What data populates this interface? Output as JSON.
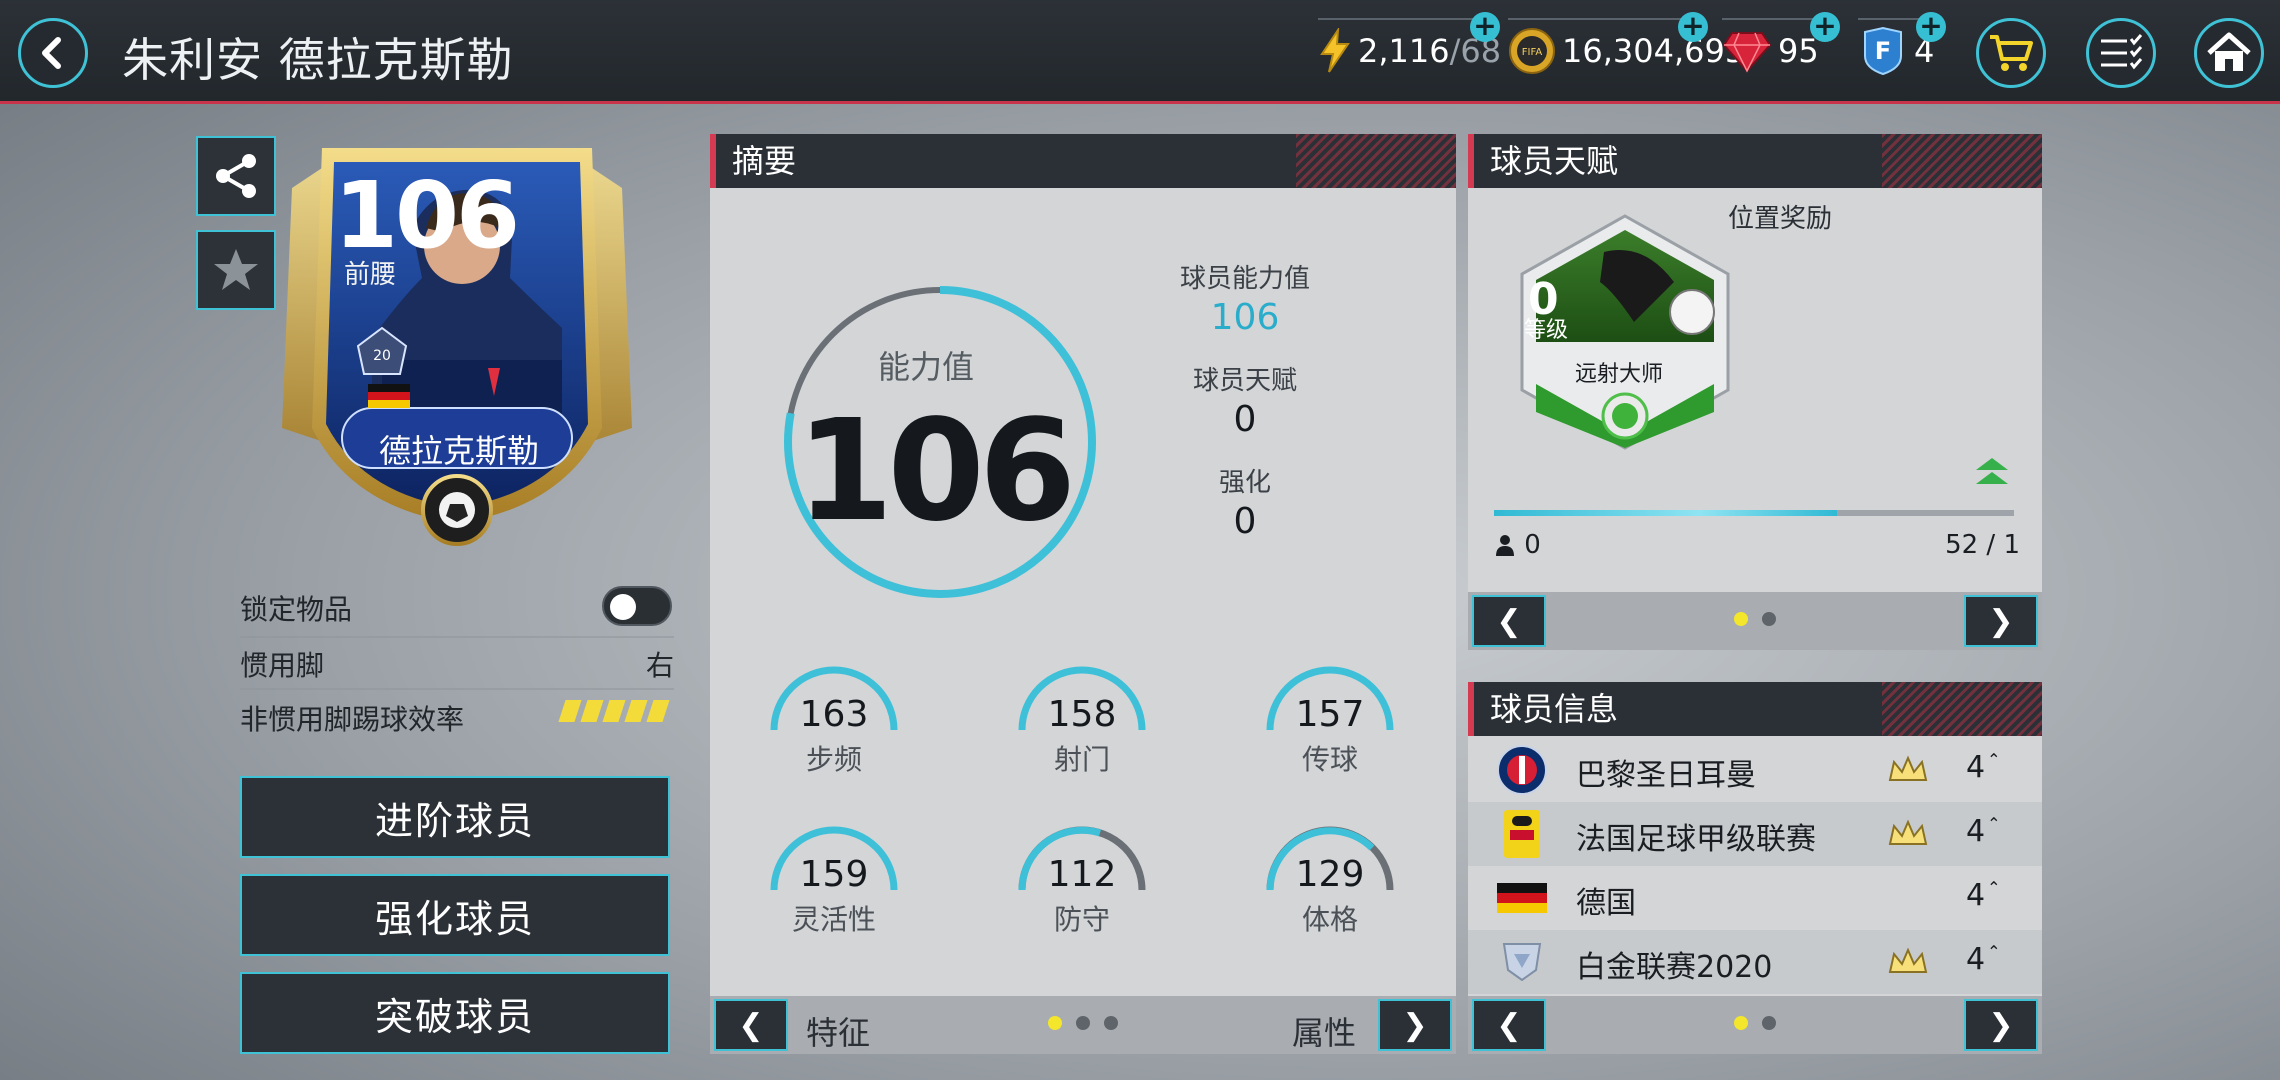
{
  "header": {
    "title": "朱利安 德拉克斯勒",
    "energy_value": "2,116",
    "energy_max": "/68",
    "coins": "16,304,695",
    "gems": "95",
    "f_points": "4",
    "coin_icon_text": "FIFA"
  },
  "player": {
    "rating": "106",
    "position": "前腰",
    "card_name": "德拉克斯勒",
    "badge_number": "20"
  },
  "left": {
    "lock_label": "锁定物品",
    "lock_on": false,
    "foot_label": "惯用脚",
    "foot_value": "右",
    "weak_foot_label": "非惯用脚踢球效率",
    "weak_foot_rating": 5,
    "buttons": [
      "进阶球员",
      "强化球员",
      "突破球员"
    ]
  },
  "summary": {
    "title": "摘要",
    "ring_label": "能力值",
    "ring_value": "106",
    "ring_fill_fraction": 0.78,
    "ability_label": "球员能力值",
    "ability_value": "106",
    "talent_label": "球员天赋",
    "talent_value": "0",
    "boost_label": "强化",
    "boost_value": "0",
    "stats": [
      {
        "label": "步频",
        "value": "163"
      },
      {
        "label": "射门",
        "value": "158"
      },
      {
        "label": "传球",
        "value": "157"
      },
      {
        "label": "灵活性",
        "value": "159"
      },
      {
        "label": "防守",
        "value": "112"
      },
      {
        "label": "体格",
        "value": "129"
      }
    ],
    "footer_left": "特征",
    "footer_right": "属性"
  },
  "talent": {
    "title": "球员天赋",
    "subtitle": "位置奖励",
    "level": "0",
    "level_label": "等级",
    "skill_name": "远射大师",
    "progress_fraction": 0.66,
    "left_value": "0",
    "right_value": "52 / 1"
  },
  "player_info": {
    "title": "球员信息",
    "rows": [
      {
        "name": "巴黎圣日耳曼",
        "level": "4",
        "crown": true
      },
      {
        "name": "法国足球甲级联赛",
        "level": "4",
        "crown": true
      },
      {
        "name": "德国",
        "level": "4",
        "crown": false
      },
      {
        "name": "白金联赛2020",
        "level": "4",
        "crown": true
      }
    ]
  },
  "colors": {
    "accent": "#3fc2d6",
    "header_red": "#d43b52",
    "highlight_blue": "#2aaccb",
    "active_dot": "#f4e62a"
  },
  "icons": {
    "back": "chevron-left-icon",
    "energy": "lightning-icon",
    "coins": "coin-icon",
    "gems": "gem-icon",
    "f_points": "f-shield-icon",
    "cart": "cart-icon",
    "list": "checklist-icon",
    "home": "home-icon",
    "share": "share-icon",
    "favorite": "star-icon"
  }
}
